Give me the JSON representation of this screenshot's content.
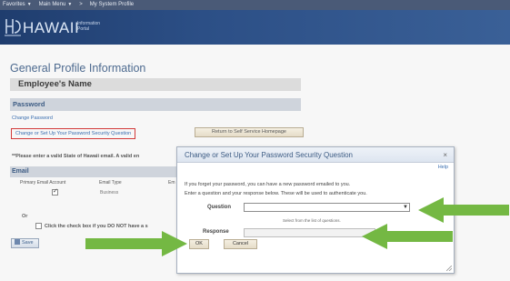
{
  "top_menu": {
    "favorites": "Favorites",
    "main_menu": "Main Menu",
    "separator": ">",
    "current_page": "My System Profile"
  },
  "brand": {
    "name": "HAWAII",
    "sub": "Information Portal"
  },
  "page": {
    "title": "General Profile Information",
    "employee_name": "Employee's Name",
    "password_section": "Password",
    "change_password_link": "Change Password",
    "security_question_link": "Change or Set Up Your Password Security Question",
    "return_button": "Return to Self Service Homepage",
    "notice": "**Please enter a valid State of Hawaii email. A valid en",
    "email_section": "Email",
    "email_columns": [
      "Primary Email Account",
      "Email Type",
      "Em"
    ],
    "email_row": {
      "type": "Business"
    },
    "or_text": "Or",
    "dnh_text": "Click the check box if you DO NOT have a s",
    "save_button": "Save"
  },
  "modal": {
    "title": "Change or Set Up Your Password Security Question",
    "close": "×",
    "help": "Help",
    "line1": "If you forget your password, you can have a new password emailed to you.",
    "line2": "Enter a question and your response below. These will be used to authenticate you.",
    "question_label": "Question",
    "select_hint": "Select from the list of questions.",
    "response_label": "Response",
    "ok_button": "OK",
    "cancel_button": "Cancel"
  },
  "colors": {
    "arrow_green": "#74b843",
    "highlight_red": "#d23a3a",
    "header_blue": "#2c4f86"
  }
}
